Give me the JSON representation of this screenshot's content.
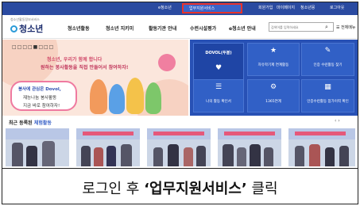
{
  "topbar": {
    "items": [
      "e청소년",
      "업무지원서비스",
      "회원가입",
      "마이페이지",
      "청소년몽",
      "로그아웃"
    ],
    "highlight_color": "#e8322a"
  },
  "header": {
    "logo_sub": "청소년활동정보서비스",
    "logo": "청소년",
    "nav": [
      "청소년활동",
      "청소년 지키미",
      "활동기관 안내",
      "수련시설평가",
      "e청소년 안내"
    ],
    "search_placeholder": "검색어를 입력하세요",
    "menu_all": "전체메뉴"
  },
  "banner": {
    "pager": "□□□□■□□□",
    "line1": "청소년, 우리가 함께 합니다",
    "line2": "원하는 봉사활동을 직접 만들어서 참여하자!",
    "bubble_a": "봉사에 관심은 Dovol,",
    "bubble_b": "재능나눔 봉사활동",
    "bubble_c": "지금 바로 참여하자!"
  },
  "tiles": {
    "main": "DOVOL(두볼)",
    "items": [
      {
        "icon": "★",
        "label": "자유학기제 연계활동"
      },
      {
        "icon": "✎",
        "label": "인증 수련활동 찾기"
      },
      {
        "icon": "⚙",
        "label": "1365연계"
      },
      {
        "icon": "▦",
        "label": "인증수련활동 참가이력 확인"
      },
      {
        "icon": "☰",
        "label": "나의 활동 확인서"
      }
    ]
  },
  "section": {
    "title_prefix": "최근 등록된",
    "title_highlight": "체험활동"
  },
  "caption": {
    "prefix": "로그인 후",
    "highlight": "‘업무지원서비스’",
    "suffix": "클릭"
  }
}
